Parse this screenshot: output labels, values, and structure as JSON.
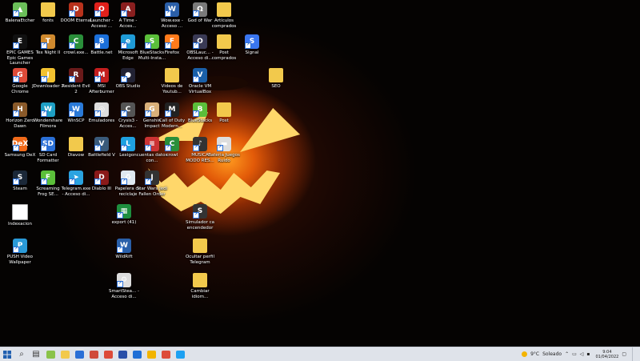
{
  "desktop": {
    "icons": [
      {
        "label": "BalenaEtcher",
        "color": "#6bbf59",
        "glyph": "▲"
      },
      {
        "label": "fonts",
        "color": "#f2c94c",
        "glyph": "",
        "kind": "folder"
      },
      {
        "label": "DOOM Eternal",
        "color": "#b8321c",
        "glyph": "D"
      },
      {
        "label": "Launcher - Acceso ...",
        "color": "#e0201b",
        "glyph": "O"
      },
      {
        "label": "A Time - Acces...",
        "color": "#8a1f1f",
        "glyph": "A"
      },
      {
        "label": "Wow.exe - Acceso ...",
        "color": "#2b5fa8",
        "glyph": "W"
      },
      {
        "label": "God of War",
        "color": "#7a7a7a",
        "glyph": "Ω"
      },
      {
        "label": "Artículos comprados",
        "color": "#f2c94c",
        "glyph": "",
        "kind": "folder"
      },
      {
        "label": "EPIC GAMES Epic Games Launcher",
        "color": "#111111",
        "glyph": "E"
      },
      {
        "label": "Tex Night II",
        "color": "#d08a2e",
        "glyph": "T"
      },
      {
        "label": "crowl.exe...",
        "color": "#2a8f3a",
        "glyph": "C"
      },
      {
        "label": "Battle.net",
        "color": "#1b6fd9",
        "glyph": "B"
      },
      {
        "label": "Microsoft Edge",
        "color": "#1f9bd6",
        "glyph": "e"
      },
      {
        "label": "BlueStacks Multi-Insta...",
        "color": "#5bbf3a",
        "glyph": "S"
      },
      {
        "label": "Firefox",
        "color": "#ff7a1a",
        "glyph": "F"
      },
      {
        "label": "OBSLauc... - Acceso di...",
        "color": "#3a3a55",
        "glyph": "O"
      },
      {
        "label": "Post comprados",
        "color": "#f2c94c",
        "glyph": "",
        "kind": "folder"
      },
      {
        "label": "Signal",
        "color": "#3a76f0",
        "glyph": "S"
      },
      {
        "label": "Google Chrome",
        "color": "#dd4b39",
        "glyph": "G"
      },
      {
        "label": "JDownloader 2",
        "color": "#f2c230",
        "glyph": "J"
      },
      {
        "label": "Resident Evil 2",
        "color": "#6a1a1a",
        "glyph": "R"
      },
      {
        "label": "MSI Afterburner",
        "color": "#c41e1e",
        "glyph": "M"
      },
      {
        "label": "OBS Studio",
        "color": "#222233",
        "glyph": "●"
      },
      {
        "label": "Videos de Youtub...",
        "color": "#f2c94c",
        "glyph": "",
        "kind": "folder"
      },
      {
        "label": "Oracle VM VirtualBox",
        "color": "#1a5fa8",
        "glyph": "V"
      },
      {
        "label": "SEO",
        "color": "#f2c94c",
        "glyph": "",
        "kind": "folder"
      },
      {
        "label": "Horizon Zero Dawn",
        "color": "#8a5a2a",
        "glyph": "H"
      },
      {
        "label": "Wondershare Filmora",
        "color": "#1e9fc4",
        "glyph": "W"
      },
      {
        "label": "WinSCP",
        "color": "#2a7ad8",
        "glyph": "W"
      },
      {
        "label": "Emuladores",
        "color": "#dddddd",
        "glyph": "◎"
      },
      {
        "label": "Crysis3 - Acces...",
        "color": "#555555",
        "glyph": "C"
      },
      {
        "label": "Genshin Impact",
        "color": "#d9b07a",
        "glyph": "G"
      },
      {
        "label": "Call of Duty Modern...",
        "color": "#222222",
        "glyph": "M"
      },
      {
        "label": "BlueStacks",
        "color": "#5bbf3a",
        "glyph": "B"
      },
      {
        "label": "Post",
        "color": "#f2c94c",
        "glyph": "",
        "kind": "folder"
      },
      {
        "label": "Samsung DeX",
        "color": "#f06a1a",
        "glyph": "DeX"
      },
      {
        "label": "SD Card Formatter",
        "color": "#2a6fd6",
        "glyph": "SD"
      },
      {
        "label": "Diavow",
        "color": "#f2c94c",
        "glyph": "",
        "kind": "folder"
      },
      {
        "label": "Battlefield V",
        "color": "#3a5a7a",
        "glyph": "V"
      },
      {
        "label": "Lexigon",
        "color": "#1fa0e0",
        "glyph": "L"
      },
      {
        "label": "cuentas datos con...",
        "color": "#cc3333",
        "glyph": "≡"
      },
      {
        "label": "crowl",
        "color": "#2a8f3a",
        "glyph": "C"
      },
      {
        "label": "MUSICA MODO RES...",
        "color": "#333333",
        "glyph": "♪"
      },
      {
        "label": "Bateria Juegos Ruido",
        "color": "#dddddd",
        "glyph": "▬"
      },
      {
        "label": "Steam",
        "color": "#1b2838",
        "glyph": "S"
      },
      {
        "label": "Screaming Frog SE...",
        "color": "#5bbf3a",
        "glyph": "F"
      },
      {
        "label": "Telegram.exe - Acceso di...",
        "color": "#2aa3e0",
        "glyph": "➤"
      },
      {
        "label": "Diablo III",
        "color": "#8a1a1a",
        "glyph": "D"
      },
      {
        "label": "Papelera de reciclaje",
        "color": "#dfe8f0",
        "glyph": "♻"
      },
      {
        "label": "Star Wars Jedi Fallen Order",
        "color": "#333333",
        "glyph": "J"
      },
      {
        "label": "Indexacion",
        "color": "#ffffff",
        "glyph": "",
        "kind": "doc"
      },
      {
        "label": "export (41)",
        "color": "#1e8e3e",
        "glyph": "▦"
      },
      {
        "label": "Simulador ca encendedor",
        "color": "#333333",
        "glyph": "S"
      },
      {
        "label": "PUSH Video Wallpaper",
        "color": "#2a9ad8",
        "glyph": "P"
      },
      {
        "label": "WildRift",
        "color": "#2a5fa8",
        "glyph": "W"
      },
      {
        "label": "Ocultar perfil Telegram",
        "color": "#f2c94c",
        "glyph": "",
        "kind": "folder"
      },
      {
        "label": "SmartStea... - Acceso di...",
        "color": "#dddddd",
        "glyph": "⚙"
      },
      {
        "label": "Cambiar idiom...",
        "color": "#f2c94c",
        "glyph": "",
        "kind": "folder"
      }
    ]
  },
  "taskbar": {
    "start_icon": "windows-logo",
    "items": [
      {
        "name": "search",
        "glyph": "⌕",
        "color": "#333333"
      },
      {
        "name": "task-view",
        "glyph": "▤",
        "color": "#333333"
      },
      {
        "name": "notepad",
        "color": "#8ac34a"
      },
      {
        "name": "file-explorer",
        "color": "#f2c94c"
      },
      {
        "name": "terminal",
        "color": "#2a6fd6"
      },
      {
        "name": "tool",
        "color": "#d04a3a"
      },
      {
        "name": "chrome",
        "color": "#dd4b39"
      },
      {
        "name": "media",
        "color": "#2a4fa8"
      },
      {
        "name": "mail",
        "color": "#1f6fd6"
      },
      {
        "name": "chrome-canary",
        "color": "#f2b400"
      },
      {
        "name": "chrome-2",
        "color": "#dd4b39"
      },
      {
        "name": "twitter",
        "color": "#1da1f2"
      }
    ],
    "weather_temp": "9°C",
    "weather_text": "Soleado",
    "time": "9:04",
    "date": "01/04/2022"
  }
}
